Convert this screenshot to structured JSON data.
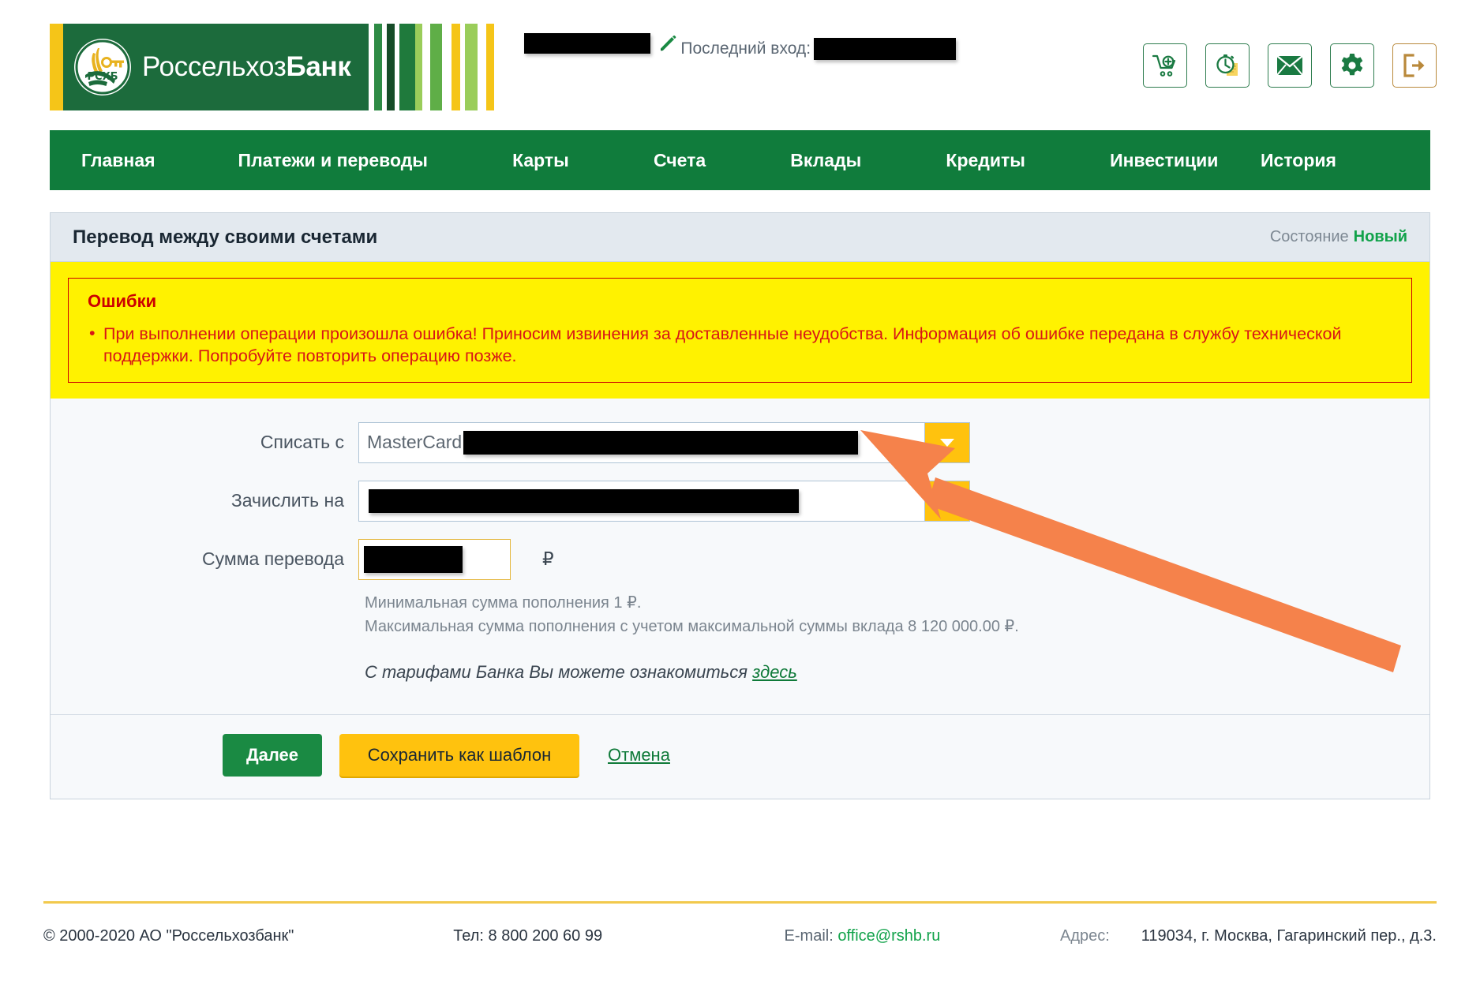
{
  "brand": {
    "name_part1": "Россельхоз",
    "name_part2": "Банк",
    "logo_icon": "wheat-key-emblem",
    "stripe_colors": [
      "#2E8B45",
      "#1C5E32",
      "#1F7A3C",
      "#9ACD5A",
      "#5FAE47",
      "#F5C518",
      "#9ACD5A",
      "#F5C518"
    ]
  },
  "header": {
    "edit_icon": "pencil-icon",
    "last_login_label": "Последний вход:",
    "icons": [
      {
        "name": "cart-add-icon",
        "title": "Корзина"
      },
      {
        "name": "history-clock-icon",
        "title": "История"
      },
      {
        "name": "mail-icon",
        "title": "Сообщения"
      },
      {
        "name": "gear-icon",
        "title": "Настройки"
      },
      {
        "name": "logout-icon",
        "title": "Выход"
      }
    ]
  },
  "nav": {
    "items": [
      {
        "label": "Главная",
        "name": "nav-item-home"
      },
      {
        "label": "Платежи и переводы",
        "name": "nav-item-payments"
      },
      {
        "label": "Карты",
        "name": "nav-item-cards"
      },
      {
        "label": "Счета",
        "name": "nav-item-accounts"
      },
      {
        "label": "Вклады",
        "name": "nav-item-deposits"
      },
      {
        "label": "Кредиты",
        "name": "nav-item-credits"
      },
      {
        "label": "Инвестиции",
        "name": "nav-item-investments"
      },
      {
        "label": "История",
        "name": "nav-item-history"
      }
    ]
  },
  "card": {
    "title": "Перевод между своими счетами",
    "status_label": "Состояние",
    "status_value": "Новый"
  },
  "error": {
    "title": "Ошибки",
    "items": [
      "При выполнении операции произошла ошибка! Приносим извинения за доставленные неудобства. Информация об ошибке передана в службу технической поддержки. Попробуйте повторить операцию позже."
    ]
  },
  "form": {
    "from_label": "Списать с",
    "from_value": "MasterCard",
    "to_label": "Зачислить на",
    "to_value": "",
    "amount_label": "Сумма перевода",
    "amount_value": "",
    "currency_symbol": "₽",
    "hint_min": "Минимальная сумма пополнения 1 ₽.",
    "hint_max": "Максимальная сумма пополнения с учетом максимальной суммы вклада 8 120 000.00 ₽.",
    "tariffs_text": "С тарифами Банка Вы можете ознакомиться",
    "tariffs_link": "здесь"
  },
  "actions": {
    "next_label": "Далее",
    "save_template_label": "Сохранить как шаблон",
    "cancel_label": "Отмена"
  },
  "footer": {
    "copyright": "© 2000-2020 АО \"Россельхозбанк\"",
    "phone": "Тел: 8 800 200 60 99",
    "email_label": "E-mail:",
    "email_value": "office@rshb.ru",
    "address_label": "Адрес:",
    "address_value": "119034, г. Москва, Гагаринский пер., д.3."
  },
  "annotation": {
    "arrow_color": "#F5824B",
    "arrow_name": "pointer-arrow-to-error"
  },
  "colors": {
    "brand_green": "#107C3C",
    "accent_yellow": "#FFC20E",
    "error_red": "#CC0000",
    "banner_yellow": "#FFF200"
  }
}
